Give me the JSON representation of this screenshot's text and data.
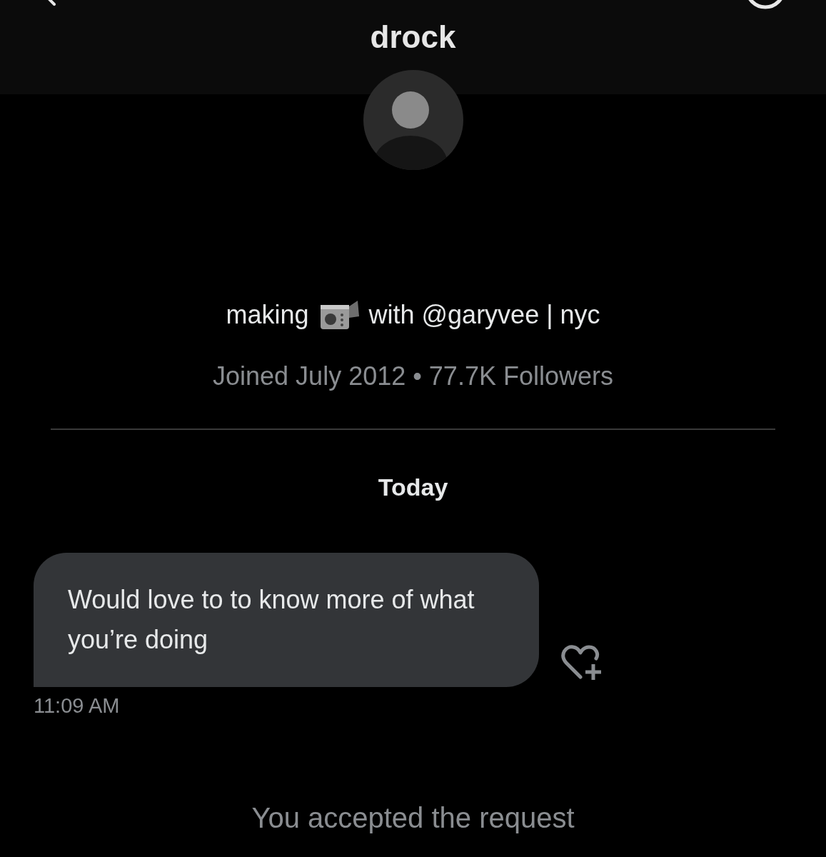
{
  "header": {
    "title": "drock"
  },
  "profile": {
    "bio_before": "making",
    "bio_after": "with @garyvee  | nyc",
    "meta": "Joined July 2012 • 77.7K Followers"
  },
  "date_divider": "Today",
  "messages": [
    {
      "text": "Would love to to know more of what  you’re doing",
      "time": "11:09 AM"
    }
  ],
  "notice": "You accepted the request"
}
